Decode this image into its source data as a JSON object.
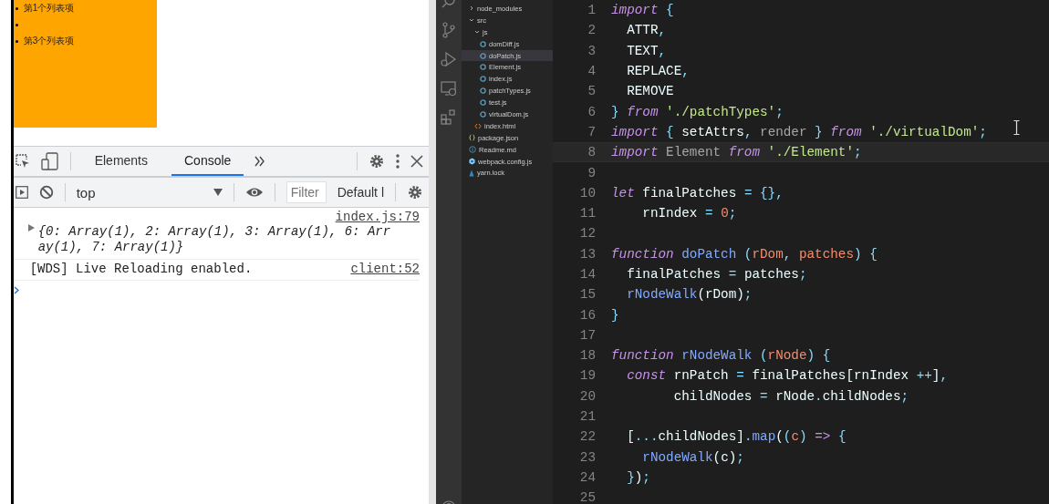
{
  "browser_page": {
    "list_items": [
      {
        "kind": "text",
        "text": "第1个列表项"
      },
      {
        "kind": "empty"
      },
      {
        "kind": "text",
        "text": "第3个列表项"
      }
    ]
  },
  "devtools": {
    "tabs": [
      {
        "label": "Elements",
        "selected": false
      },
      {
        "label": "Console",
        "selected": true
      }
    ],
    "context": "top",
    "filter": {
      "placeholder": "Filter"
    },
    "levels": "Default l",
    "messages": [
      {
        "kind": "object",
        "source": "index.js:79",
        "text": "{0: Array(1), 2: Array(1), 3: Array(1), 6: Array(1), 7: Array(1)}"
      },
      {
        "kind": "log",
        "source": "client:52",
        "text": "[WDS] Live Reloading enabled."
      }
    ]
  },
  "explorer": {
    "items": [
      {
        "name": "node_modules",
        "kind": "folder",
        "expanded": false,
        "selected": false
      },
      {
        "name": "src",
        "kind": "folder",
        "expanded": true,
        "selected": false,
        "children": [
          {
            "name": "js",
            "kind": "folder",
            "expanded": true,
            "selected": false,
            "children": [
              {
                "name": "domDiff.js",
                "kind": "js",
                "selected": false
              },
              {
                "name": "doPatch.js",
                "kind": "js",
                "selected": true
              },
              {
                "name": "Element.js",
                "kind": "js",
                "selected": false
              },
              {
                "name": "index.js",
                "kind": "js",
                "selected": false
              },
              {
                "name": "patchTypes.js",
                "kind": "js",
                "selected": false
              },
              {
                "name": "test.js",
                "kind": "js",
                "selected": false
              },
              {
                "name": "virtualDom.js",
                "kind": "js",
                "selected": false
              }
            ]
          },
          {
            "name": "index.html",
            "kind": "html",
            "selected": false
          }
        ]
      },
      {
        "name": "package.json",
        "kind": "json",
        "selected": false
      },
      {
        "name": "Readme.md",
        "kind": "info",
        "selected": false
      },
      {
        "name": "webpack.config.js",
        "kind": "webpack",
        "selected": false
      },
      {
        "name": "yarn.lock",
        "kind": "yarn",
        "selected": false
      }
    ]
  },
  "editor": {
    "lines": [
      {
        "num": "1",
        "current": false,
        "tokens": [
          {
            "kind": "kw",
            "t": "import"
          },
          {
            "kind": "p",
            "t": " {"
          }
        ]
      },
      {
        "num": "2",
        "current": false,
        "tokens": [
          {
            "kind": "id",
            "t": "  ATTR"
          },
          {
            "kind": "p",
            "t": ","
          }
        ]
      },
      {
        "num": "3",
        "current": false,
        "tokens": [
          {
            "kind": "id",
            "t": "  TEXT"
          },
          {
            "kind": "p",
            "t": ","
          }
        ]
      },
      {
        "num": "4",
        "current": false,
        "tokens": [
          {
            "kind": "id",
            "t": "  REPLACE"
          },
          {
            "kind": "p",
            "t": ","
          }
        ]
      },
      {
        "num": "5",
        "current": false,
        "tokens": [
          {
            "kind": "id",
            "t": "  REMOVE"
          }
        ]
      },
      {
        "num": "6",
        "current": false,
        "tokens": [
          {
            "kind": "p",
            "t": "} "
          },
          {
            "kind": "kw",
            "t": "from "
          },
          {
            "kind": "str",
            "t": "'./patchTypes'"
          },
          {
            "kind": "p",
            "t": ";"
          }
        ]
      },
      {
        "num": "7",
        "current": false,
        "tokens": [
          {
            "kind": "kw",
            "t": "import "
          },
          {
            "kind": "p",
            "t": "{ "
          },
          {
            "kind": "id",
            "t": "setAttrs"
          },
          {
            "kind": "p",
            "t": ", "
          },
          {
            "kind": "dim",
            "t": "render "
          },
          {
            "kind": "p",
            "t": "} "
          },
          {
            "kind": "kw",
            "t": "from "
          },
          {
            "kind": "str",
            "t": "'./virtualDom'"
          },
          {
            "kind": "p",
            "t": ";"
          }
        ]
      },
      {
        "num": "8",
        "current": true,
        "tokens": [
          {
            "kind": "kw",
            "t": "import "
          },
          {
            "kind": "dim",
            "t": "Element "
          },
          {
            "kind": "kw",
            "t": "from "
          },
          {
            "kind": "str",
            "t": "'./Element'"
          },
          {
            "kind": "p",
            "t": ";"
          }
        ]
      },
      {
        "num": "9",
        "current": false
      },
      {
        "num": "10",
        "current": false,
        "tokens": [
          {
            "kind": "kw",
            "t": "let "
          },
          {
            "kind": "id",
            "t": "finalPatches "
          },
          {
            "kind": "p",
            "t": "= {},"
          }
        ]
      },
      {
        "num": "11",
        "current": false,
        "tokens": [
          {
            "kind": "id",
            "t": "    rnIndex "
          },
          {
            "kind": "p",
            "t": "= "
          },
          {
            "kind": "num",
            "t": "0"
          },
          {
            "kind": "p",
            "t": ";"
          }
        ]
      },
      {
        "num": "12",
        "current": false
      },
      {
        "num": "13",
        "current": false,
        "tokens": [
          {
            "kind": "kw",
            "t": "function "
          },
          {
            "kind": "fn",
            "t": "doPatch "
          },
          {
            "kind": "p",
            "t": "("
          },
          {
            "kind": "param",
            "t": "rDom"
          },
          {
            "kind": "p",
            "t": ", "
          },
          {
            "kind": "param",
            "t": "patches"
          },
          {
            "kind": "p",
            "t": ") {"
          }
        ]
      },
      {
        "num": "14",
        "current": false,
        "tokens": [
          {
            "kind": "id",
            "t": "  finalPatches "
          },
          {
            "kind": "p",
            "t": "= "
          },
          {
            "kind": "id",
            "t": "patches"
          },
          {
            "kind": "p",
            "t": ";"
          }
        ]
      },
      {
        "num": "15",
        "current": false,
        "tokens": [
          {
            "kind": "fn",
            "t": "  rNodeWalk"
          },
          {
            "kind": "id",
            "t": "(rDom)"
          },
          {
            "kind": "p",
            "t": ";"
          }
        ]
      },
      {
        "num": "16",
        "current": false,
        "tokens": [
          {
            "kind": "p",
            "t": "}"
          }
        ]
      },
      {
        "num": "17",
        "current": false
      },
      {
        "num": "18",
        "current": false,
        "tokens": [
          {
            "kind": "kw",
            "t": "function "
          },
          {
            "kind": "fn",
            "t": "rNodeWalk "
          },
          {
            "kind": "p",
            "t": "("
          },
          {
            "kind": "param",
            "t": "rNode"
          },
          {
            "kind": "p",
            "t": ") {"
          }
        ]
      },
      {
        "num": "19",
        "current": false,
        "tokens": [
          {
            "kind": "kw",
            "t": "  const "
          },
          {
            "kind": "id",
            "t": "rnPatch "
          },
          {
            "kind": "p",
            "t": "= "
          },
          {
            "kind": "id",
            "t": "finalPatches[rnIndex "
          },
          {
            "kind": "p",
            "t": "++"
          },
          {
            "kind": "id",
            "t": "]"
          },
          {
            "kind": "p",
            "t": ","
          }
        ]
      },
      {
        "num": "20",
        "current": false,
        "tokens": [
          {
            "kind": "id",
            "t": "        childNodes "
          },
          {
            "kind": "p",
            "t": "= "
          },
          {
            "kind": "id",
            "t": "rNode"
          },
          {
            "kind": "p",
            "t": "."
          },
          {
            "kind": "id",
            "t": "childNodes"
          },
          {
            "kind": "p",
            "t": ";"
          }
        ]
      },
      {
        "num": "21",
        "current": false
      },
      {
        "num": "22",
        "current": false,
        "tokens": [
          {
            "kind": "id",
            "t": "  ["
          },
          {
            "kind": "p",
            "t": "..."
          },
          {
            "kind": "id",
            "t": "childNodes]"
          },
          {
            "kind": "p",
            "t": "."
          },
          {
            "kind": "fn",
            "t": "map"
          },
          {
            "kind": "id",
            "t": "("
          },
          {
            "kind": "p",
            "t": "("
          },
          {
            "kind": "param",
            "t": "c"
          },
          {
            "kind": "p",
            "t": ") "
          },
          {
            "kind": "kw",
            "t": "=> "
          },
          {
            "kind": "p",
            "t": "{"
          }
        ]
      },
      {
        "num": "23",
        "current": false,
        "tokens": [
          {
            "kind": "fn",
            "t": "    rNodeWalk"
          },
          {
            "kind": "id",
            "t": "(c)"
          },
          {
            "kind": "p",
            "t": ";"
          }
        ]
      },
      {
        "num": "24",
        "current": false,
        "tokens": [
          {
            "kind": "p",
            "t": "  }"
          },
          {
            "kind": "id",
            "t": ")"
          },
          {
            "kind": "p",
            "t": ";"
          }
        ]
      },
      {
        "num": "25",
        "current": false
      }
    ]
  }
}
